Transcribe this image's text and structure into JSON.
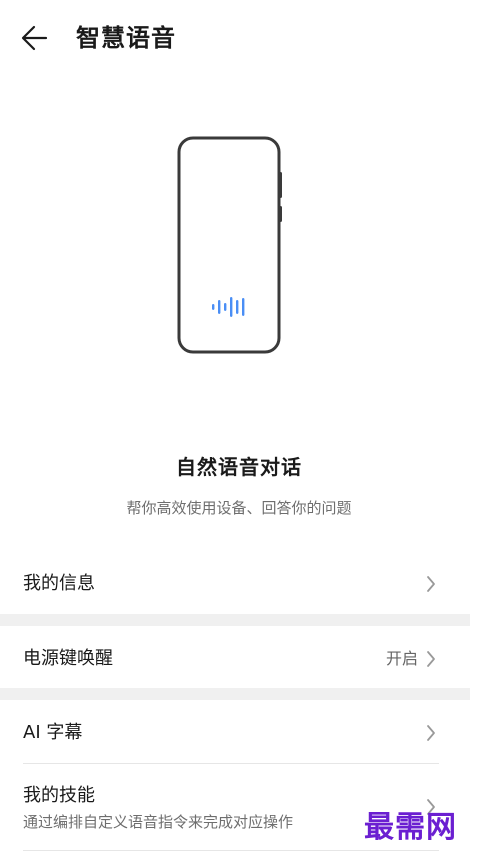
{
  "header": {
    "title": "智慧语音"
  },
  "hero": {
    "title": "自然语音对话",
    "subtitle": "帮你高效使用设备、回答你的问题"
  },
  "settings": [
    {
      "label": "我的信息"
    },
    {
      "label": "电源键唤醒",
      "value": "开启"
    },
    {
      "label": "AI 字幕"
    },
    {
      "label": "我的技能",
      "subtitle": "通过编排自定义语音指令来完成对应操作"
    }
  ],
  "watermark": "最需网",
  "colors": {
    "accent": "#4a8ef5",
    "phone_outline": "#3a3a3a",
    "watermark": "#6b1fd1",
    "section_gap": "#f0f0f0"
  }
}
